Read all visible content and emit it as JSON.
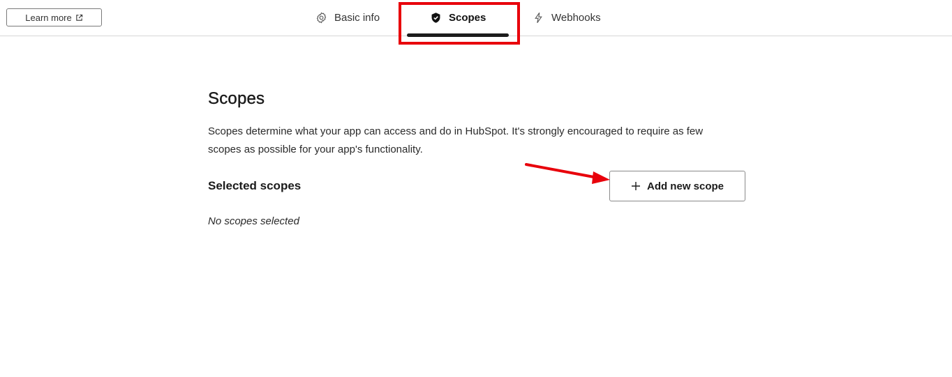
{
  "header": {
    "learn_more_label": "Learn more",
    "tabs": [
      {
        "label": "Basic info",
        "icon": "gear-icon",
        "active": false
      },
      {
        "label": "Scopes",
        "icon": "shield-icon",
        "active": true
      },
      {
        "label": "Webhooks",
        "icon": "lightning-icon",
        "active": false
      }
    ]
  },
  "main": {
    "title": "Scopes",
    "description": "Scopes determine what your app can access and do in HubSpot. It's strongly encouraged to require as few scopes as possible for your app's functionality.",
    "selected_scopes_title": "Selected scopes",
    "add_scope_label": "Add new scope",
    "empty_label": "No scopes selected"
  },
  "colors": {
    "highlight": "#e8000b",
    "annotation_arrow": "#e8000b",
    "active_tab_underline": "#1c1c1c"
  }
}
